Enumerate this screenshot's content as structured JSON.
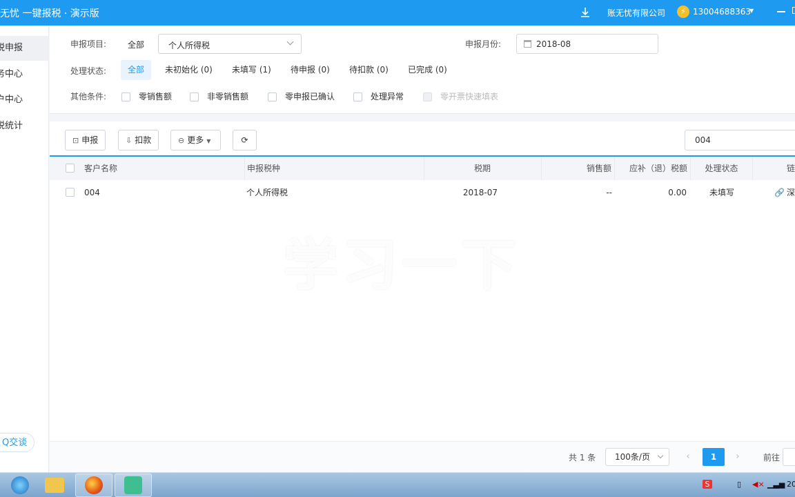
{
  "header": {
    "app_title": "无忧 一键报税 · 演示版",
    "company": "账无忧有限公司",
    "phone": "13004688363",
    "user_badge": "⚡",
    "download_icon": "download-icon",
    "accent": "#1e9bf0"
  },
  "sidebar": {
    "items": [
      {
        "label": "税申报"
      },
      {
        "label": "务中心"
      },
      {
        "label": "户中心"
      },
      {
        "label": "税统计"
      }
    ],
    "qq_chat": "Q交谈"
  },
  "filter": {
    "project_label": "申报项目:",
    "project_all": "全部",
    "project_select": "个人所得税",
    "month_label": "申报月份:",
    "month_value": "2018-08",
    "status_label": "处理状态:",
    "statuses": [
      "全部",
      "未初始化 (0)",
      "未填写 (1)",
      "待申报 (0)",
      "待扣款 (0)",
      "已完成 (0)"
    ],
    "other_label": "其他条件:",
    "options": [
      "零销售额",
      "非零销售额",
      "零申报已确认",
      "处理异常",
      "零开票快速填表"
    ]
  },
  "toolbar": {
    "declare": "申报",
    "deduct": "扣款",
    "more": "更多",
    "search_value": "004"
  },
  "table": {
    "columns": [
      "客户名称",
      "申报税种",
      "税期",
      "销售额",
      "应补（退）税额",
      "处理状态",
      "链"
    ],
    "rows": [
      {
        "name": "004",
        "tax_type": "个人所得税",
        "period": "2018-07",
        "sales": "--",
        "tax_due": "0.00",
        "status": "未填写",
        "link": "深"
      }
    ]
  },
  "watermark": "学习一下",
  "pagination": {
    "total": "共 1 条",
    "page_size": "100条/页",
    "current_page": "1",
    "goto_label": "前往",
    "prev": "‹",
    "next": "›"
  },
  "taskbar": {
    "clock": "20",
    "ime": "S"
  }
}
